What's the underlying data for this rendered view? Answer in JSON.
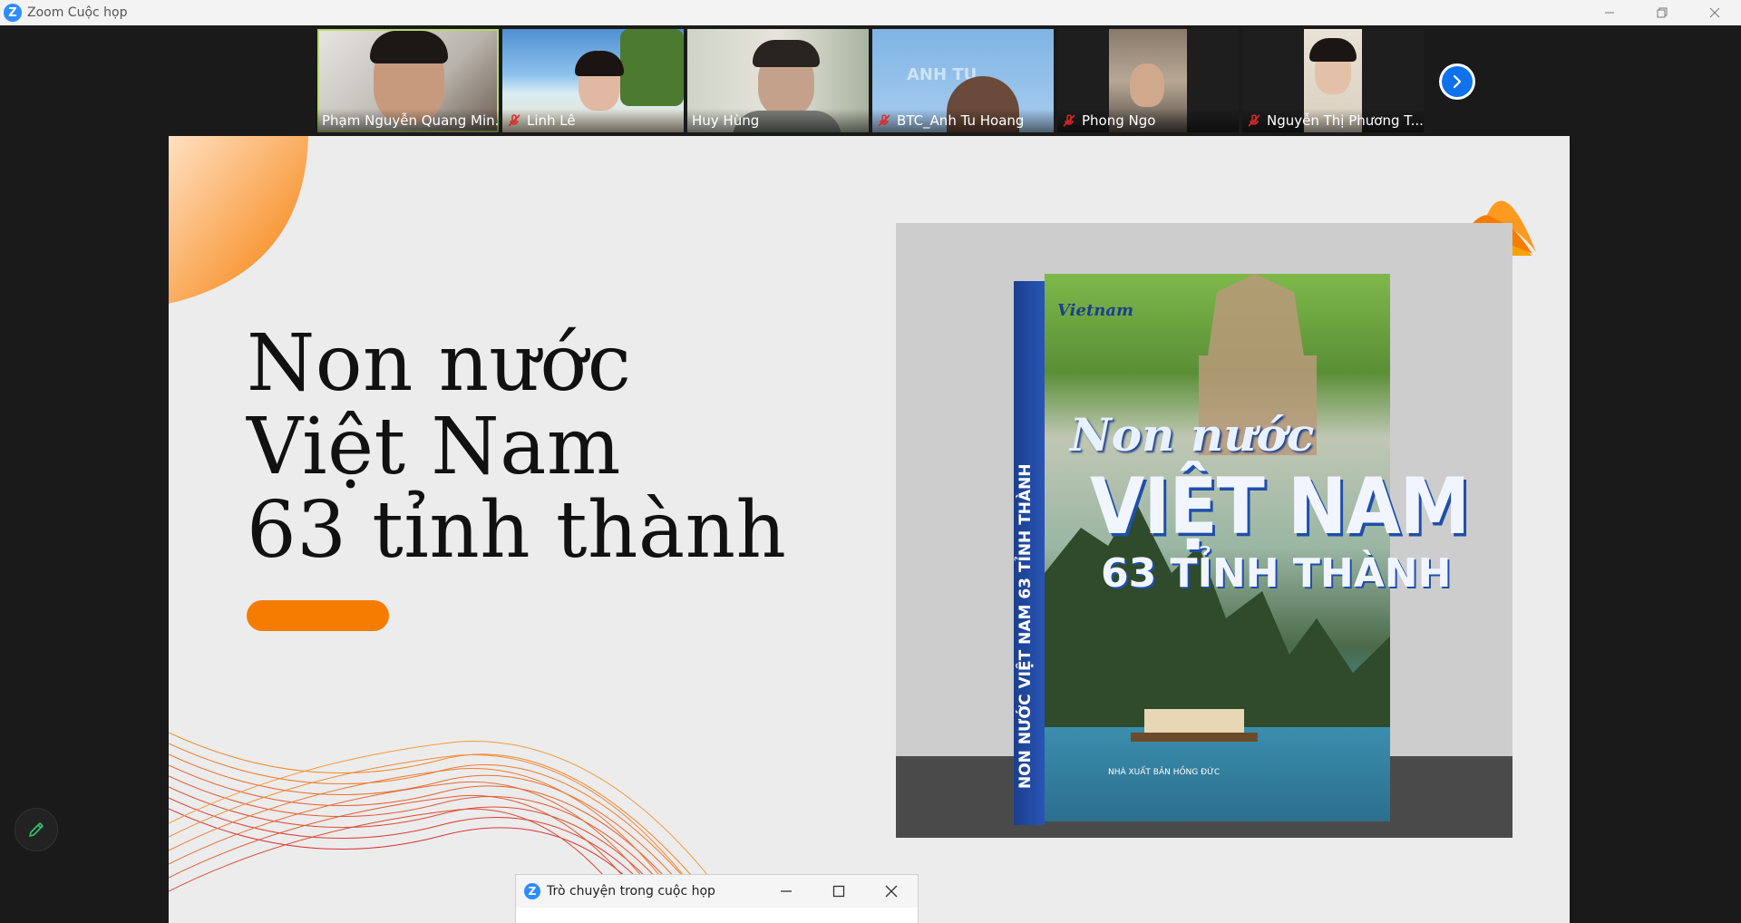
{
  "window": {
    "title": "Zoom Cuộc họp",
    "logo_letter": "Z"
  },
  "gallery": {
    "participants": [
      {
        "name": "Phạm Nguyễn Quang Min...",
        "muted": false,
        "active": true
      },
      {
        "name": "Linh Lê",
        "muted": true,
        "active": false
      },
      {
        "name": "Huy Hùng",
        "muted": false,
        "active": false
      },
      {
        "name": "BTC_Anh Tu Hoang",
        "muted": true,
        "active": false,
        "overlay_text": "ANH TU"
      },
      {
        "name": "Phong Ngo",
        "muted": true,
        "active": false
      },
      {
        "name": "Nguyễn Thị Phương T...",
        "muted": true,
        "active": false
      }
    ],
    "next_icon": "chevron-right-icon"
  },
  "slide": {
    "title_lines": [
      "Non nước",
      "Việt Nam",
      "63 tỉnh thành"
    ],
    "accent_color": "#f57c00",
    "book": {
      "spine_text": "NON NƯỚC VIỆT NAM 63 TỈNH THÀNH",
      "brand": "Vietnam",
      "script_title": "Non nước",
      "big_title": "VIỆT NAM",
      "subtitle": "63 TỈNH THÀNH",
      "publisher": "NHÀ XUẤT BẢN HỒNG ĐỨC"
    }
  },
  "chat": {
    "title": "Trò chuyện trong cuộc họp",
    "logo_letter": "Z"
  }
}
